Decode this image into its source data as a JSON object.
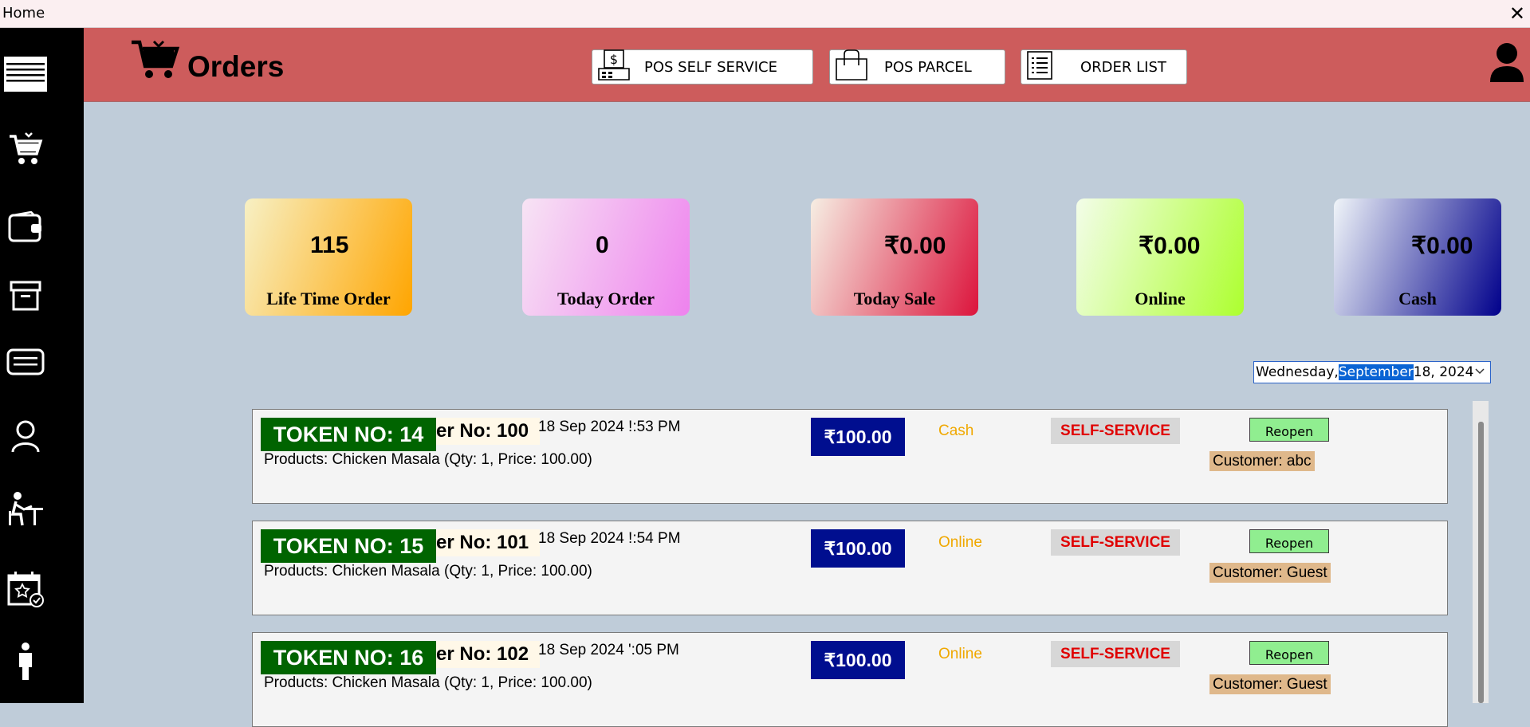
{
  "window": {
    "title": "Home",
    "close_glyph": "✕"
  },
  "sidebar": {
    "icons": [
      "menu-icon",
      "cart-icon",
      "wallet-icon",
      "archive-icon",
      "ticket-icon",
      "user-icon",
      "seat-icon",
      "calendar-star-icon",
      "person-icon"
    ]
  },
  "header": {
    "title": "Orders",
    "buttons": [
      {
        "label": "POS SELF SERVICE",
        "icon": "register-icon"
      },
      {
        "label": "POS PARCEL",
        "icon": "bag-icon"
      },
      {
        "label": "ORDER LIST",
        "icon": "list-icon"
      }
    ]
  },
  "stats": [
    {
      "value": "115",
      "label": "Life Time Order",
      "colors": [
        "#f7f0c4",
        "#ffa500"
      ]
    },
    {
      "value": "0",
      "label": "Today Order",
      "colors": [
        "#f7e4f4",
        "#ee82ee"
      ]
    },
    {
      "value": "₹0.00",
      "label": "Today Sale",
      "colors": [
        "#f6eee3",
        "#dc143c"
      ]
    },
    {
      "value": "₹0.00",
      "label": "Online",
      "colors": [
        "#f3fde9",
        "#adff2f"
      ]
    },
    {
      "value": "₹0.00",
      "label": "Cash",
      "colors": [
        "#f0f5f9",
        "#00008b"
      ]
    }
  ],
  "date_picker": {
    "before": "Wednesday, ",
    "selected": "September",
    "after": " 18, 2024"
  },
  "orders": [
    {
      "token": "TOKEN NO: 14",
      "order_no": "er No: 100",
      "time": "18 Sep 2024 !:53 PM",
      "products": "Products: Chicken Masala (Qty: 1, Price: 100.00)",
      "amount": "₹100.00",
      "payment": "Cash",
      "service": "SELF-SERVICE",
      "reopen": "Reopen",
      "customer": "Customer: abc"
    },
    {
      "token": "TOKEN NO: 15",
      "order_no": "er No: 101",
      "time": "18 Sep 2024 !:54 PM",
      "products": "Products: Chicken Masala (Qty: 1, Price: 100.00)",
      "amount": "₹100.00",
      "payment": "Online",
      "service": "SELF-SERVICE",
      "reopen": "Reopen",
      "customer": "Customer: Guest"
    },
    {
      "token": "TOKEN NO: 16",
      "order_no": "er No: 102",
      "time": "18 Sep 2024 ':05 PM",
      "products": "Products: Chicken Masala (Qty: 1, Price: 100.00)",
      "amount": "₹100.00",
      "payment": "Online",
      "service": "SELF-SERVICE",
      "reopen": "Reopen",
      "customer": "Customer: Guest"
    }
  ]
}
